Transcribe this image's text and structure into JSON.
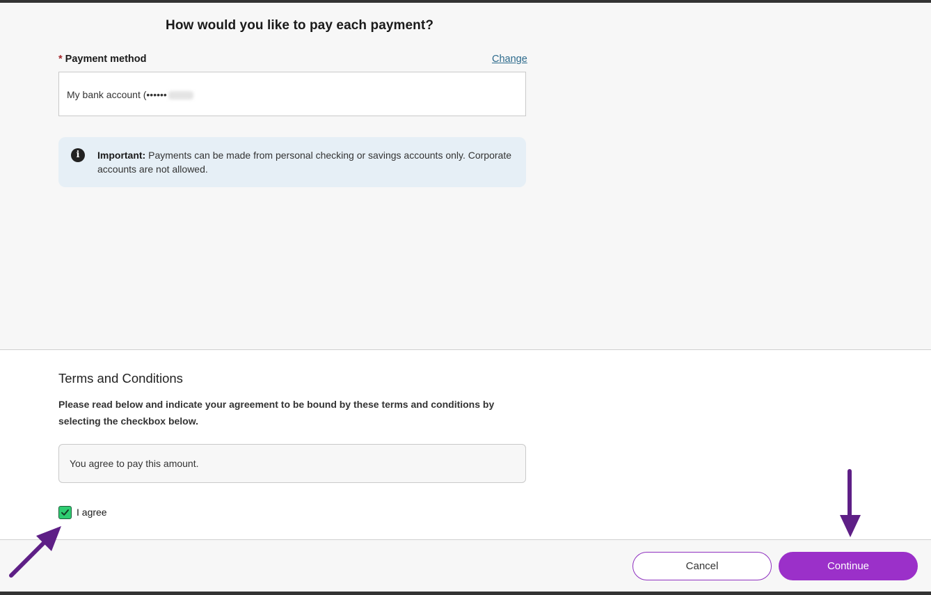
{
  "page": {
    "title": "How would you like to pay each payment?"
  },
  "payment_method": {
    "required_mark": "*",
    "label": "Payment method",
    "change_label": "Change",
    "value": "My bank account (••••••"
  },
  "info": {
    "icon": "info-icon",
    "bold": "Important:",
    "text": "Payments can be made from personal checking or savings accounts only. Corporate accounts are not allowed."
  },
  "terms": {
    "title": "Terms and Conditions",
    "description": "Please read below and indicate your agreement to be bound by these terms and conditions by selecting the checkbox below.",
    "box_text": "You agree to pay this amount.",
    "agree_label": "I agree",
    "agree_checked": true
  },
  "footer": {
    "cancel_label": "Cancel",
    "continue_label": "Continue"
  },
  "colors": {
    "accent": "#9b30c9",
    "checkbox": "#2ecc71",
    "link": "#2c6a8c",
    "info_bg": "#e6eff6",
    "annotation_arrow": "#5e1f86"
  }
}
